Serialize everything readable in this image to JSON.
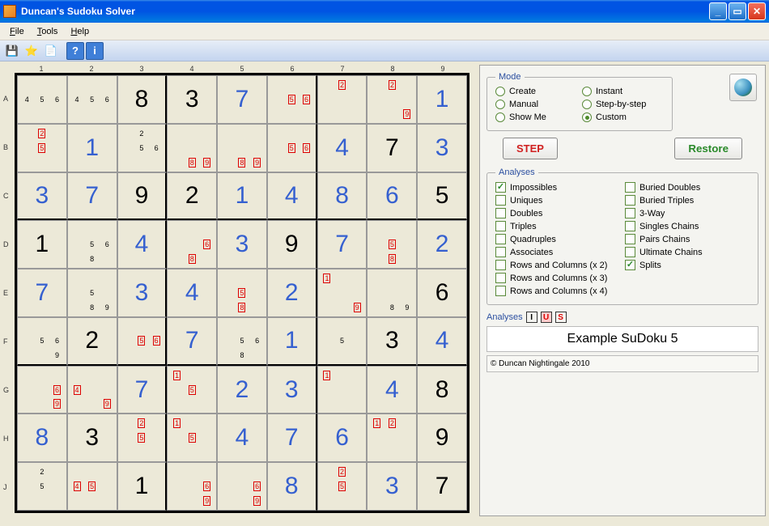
{
  "window": {
    "title": "Duncan's Sudoku Solver"
  },
  "menu": {
    "file": "File",
    "tools": "Tools",
    "help": "Help"
  },
  "toolbar": {
    "help_q": "?",
    "info_i": "i"
  },
  "mode": {
    "legend": "Mode",
    "options": [
      "Create",
      "Instant",
      "Manual",
      "Step-by-step",
      "Show Me",
      "Custom"
    ],
    "selected": "Custom"
  },
  "buttons": {
    "step": "STEP",
    "restore": "Restore"
  },
  "analyses": {
    "legend": "Analyses",
    "left": [
      "Impossibles",
      "Uniques",
      "Doubles",
      "Triples",
      "Quadruples",
      "Associates",
      "Rows and Columns (x 2)",
      "Rows and Columns (x 3)",
      "Rows and Columns (x 4)"
    ],
    "right": [
      "Buried Doubles",
      "Buried Triples",
      "3-Way",
      "Singles Chains",
      "Pairs Chains",
      "Ultimate Chains",
      "Splits"
    ],
    "checked": [
      "Impossibles",
      "Splits"
    ]
  },
  "status": {
    "label": "Analyses",
    "indicators": [
      "I",
      "U",
      "S"
    ],
    "puzzle_name": "Example SuDoku 5",
    "copyright": "© Duncan Nightingale 2010"
  },
  "grid": {
    "columns": [
      "1",
      "2",
      "3",
      "4",
      "5",
      "6",
      "7",
      "8",
      "9"
    ],
    "rows": [
      "A",
      "B",
      "C",
      "D",
      "E",
      "F",
      "G",
      "H",
      "J"
    ],
    "cells": [
      [
        {
          "c": [
            "4",
            "5",
            "6"
          ]
        },
        {
          "c": [
            "4",
            "5",
            "6"
          ]
        },
        {
          "v": "8",
          "t": "g"
        },
        {
          "v": "3",
          "t": "g"
        },
        {
          "v": "7",
          "t": "s"
        },
        {
          "e": [
            "5",
            "6"
          ],
          "ep": [
            5,
            6
          ]
        },
        {
          "e": [
            "2"
          ],
          "ep": [
            2
          ]
        },
        {
          "e": [
            "2",
            "9"
          ],
          "ep": [
            2,
            9
          ]
        },
        {
          "v": "1",
          "t": "s"
        }
      ],
      [
        {
          "e": [
            "2",
            "5"
          ],
          "ep": [
            2,
            5
          ]
        },
        {
          "v": "1",
          "t": "s"
        },
        {
          "c": [
            "2",
            "5",
            "6"
          ]
        },
        {
          "e": [
            "8",
            "9"
          ],
          "ep": [
            8,
            9
          ]
        },
        {
          "e": [
            "8",
            "9"
          ],
          "ep": [
            8,
            9
          ]
        },
        {
          "e": [
            "5",
            "6"
          ],
          "ep": [
            5,
            6
          ]
        },
        {
          "v": "4",
          "t": "s"
        },
        {
          "v": "7",
          "t": "g"
        },
        {
          "v": "3",
          "t": "s"
        }
      ],
      [
        {
          "v": "3",
          "t": "s"
        },
        {
          "v": "7",
          "t": "s"
        },
        {
          "v": "9",
          "t": "g"
        },
        {
          "v": "2",
          "t": "g"
        },
        {
          "v": "1",
          "t": "s"
        },
        {
          "v": "4",
          "t": "s"
        },
        {
          "v": "8",
          "t": "s"
        },
        {
          "v": "6",
          "t": "s"
        },
        {
          "v": "5",
          "t": "g"
        }
      ],
      [
        {
          "v": "1",
          "t": "g"
        },
        {
          "c": [
            "5",
            "6",
            "8"
          ]
        },
        {
          "v": "4",
          "t": "s"
        },
        {
          "e": [
            "6",
            "8"
          ],
          "ep": [
            6,
            8
          ]
        },
        {
          "v": "3",
          "t": "s"
        },
        {
          "v": "9",
          "t": "g"
        },
        {
          "v": "7",
          "t": "s"
        },
        {
          "e": [
            "5",
            "8"
          ],
          "ep": [
            5,
            8
          ]
        },
        {
          "v": "2",
          "t": "s"
        }
      ],
      [
        {
          "v": "7",
          "t": "s"
        },
        {
          "c": [
            "5",
            "8",
            "9"
          ]
        },
        {
          "v": "3",
          "t": "s"
        },
        {
          "v": "4",
          "t": "s"
        },
        {
          "e": [
            "5",
            "8"
          ],
          "ep": [
            5,
            8
          ]
        },
        {
          "v": "2",
          "t": "s"
        },
        {
          "e": [
            "1",
            "9"
          ],
          "ep": [
            1,
            9
          ],
          "c": [
            "1"
          ]
        },
        {
          "c": [
            "8",
            "9"
          ]
        },
        {
          "v": "6",
          "t": "g"
        }
      ],
      [
        {
          "c": [
            "5",
            "6",
            "9"
          ]
        },
        {
          "v": "2",
          "t": "g"
        },
        {
          "e": [
            "5",
            "6"
          ],
          "ep": [
            5,
            6
          ]
        },
        {
          "v": "7",
          "t": "s"
        },
        {
          "c": [
            "5",
            "6",
            "8"
          ]
        },
        {
          "v": "1",
          "t": "s"
        },
        {
          "c": [
            "5"
          ]
        },
        {
          "v": "3",
          "t": "g"
        },
        {
          "v": "4",
          "t": "s"
        }
      ],
      [
        {
          "e": [
            "6",
            "9"
          ],
          "ep": [
            6,
            9
          ]
        },
        {
          "e": [
            "4",
            "9"
          ],
          "ep": [
            4,
            9
          ]
        },
        {
          "v": "7",
          "t": "s"
        },
        {
          "e": [
            "1",
            "5"
          ],
          "ep": [
            1,
            5
          ]
        },
        {
          "v": "2",
          "t": "s"
        },
        {
          "v": "3",
          "t": "s"
        },
        {
          "e": [
            "1"
          ],
          "ep": [
            1
          ]
        },
        {
          "v": "4",
          "t": "s"
        },
        {
          "v": "8",
          "t": "g"
        }
      ],
      [
        {
          "v": "8",
          "t": "s"
        },
        {
          "v": "3",
          "t": "g"
        },
        {
          "e": [
            "2",
            "5"
          ],
          "ep": [
            2,
            5
          ]
        },
        {
          "e": [
            "1",
            "5"
          ],
          "ep": [
            1,
            5
          ]
        },
        {
          "v": "4",
          "t": "s"
        },
        {
          "v": "7",
          "t": "s"
        },
        {
          "v": "6",
          "t": "s"
        },
        {
          "e": [
            "1",
            "2"
          ],
          "ep": [
            1,
            2
          ]
        },
        {
          "v": "9",
          "t": "g"
        }
      ],
      [
        {
          "c": [
            "2",
            "5"
          ]
        },
        {
          "e": [
            "4",
            "5"
          ],
          "ep": [
            4,
            5
          ]
        },
        {
          "v": "1",
          "t": "g"
        },
        {
          "e": [
            "6",
            "9"
          ],
          "ep": [
            6,
            9
          ]
        },
        {
          "e": [
            "6",
            "9"
          ],
          "ep": [
            6,
            9
          ]
        },
        {
          "v": "8",
          "t": "s"
        },
        {
          "e": [
            "2",
            "5"
          ],
          "ep": [
            2,
            5
          ]
        },
        {
          "v": "3",
          "t": "s"
        },
        {
          "v": "7",
          "t": "g"
        }
      ]
    ]
  }
}
